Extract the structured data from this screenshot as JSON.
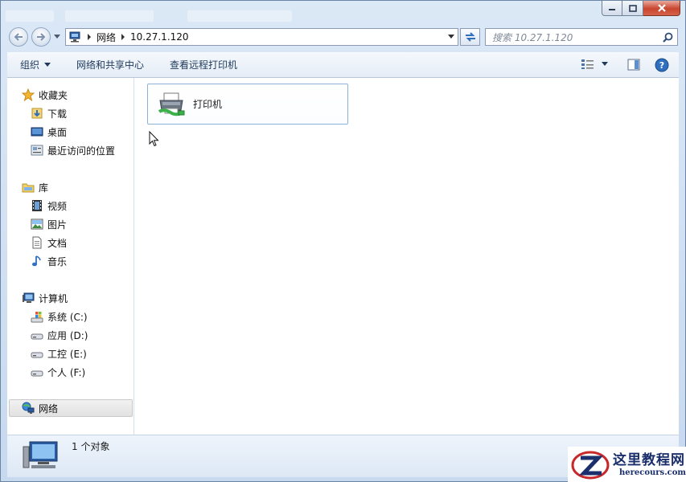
{
  "address": {
    "crumbs": [
      "网络",
      "10.27.1.120"
    ]
  },
  "search": {
    "placeholder": "搜索 10.27.1.120"
  },
  "toolbar": {
    "organize_label": "组织",
    "network_center_label": "网络和共享中心",
    "view_printers_label": "查看远程打印机"
  },
  "nav": {
    "favorites": {
      "label": "收藏夹",
      "items": [
        "下载",
        "桌面",
        "最近访问的位置"
      ]
    },
    "libraries": {
      "label": "库",
      "items": [
        "视频",
        "图片",
        "文档",
        "音乐"
      ]
    },
    "computer": {
      "label": "计算机",
      "items": [
        "系统 (C:)",
        "应用 (D:)",
        "工控 (E:)",
        "个人 (F:)"
      ]
    },
    "network": {
      "label": "网络"
    }
  },
  "content": {
    "items": [
      {
        "label": "打印机"
      }
    ]
  },
  "details": {
    "count_text": "1 个对象"
  },
  "watermark": {
    "title": "这里教程网",
    "url": "herecours.com"
  },
  "colors": {
    "accent": "#3a6fb8",
    "close_button": "#c9452f",
    "selection_border": "#8fb1d8"
  }
}
